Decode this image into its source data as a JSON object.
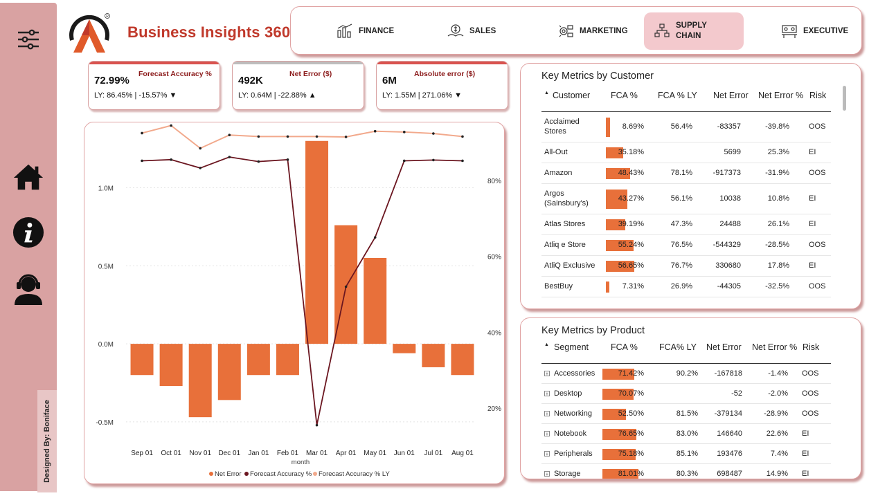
{
  "app": {
    "brand": "Business Insights 360",
    "designed_by": "Designed By: Boniface",
    "colors": {
      "accent": "#c0392b",
      "sidebar": "#d9a2a2",
      "bar": "#e8703a",
      "fca_line": "#6b1620",
      "fca_ly_line": "#f2a98c",
      "active_tab": "#f3c9cd"
    }
  },
  "sidebar": {
    "items": [
      {
        "icon": "filter-sliders-icon"
      },
      {
        "icon": "home-icon"
      },
      {
        "icon": "info-icon"
      },
      {
        "icon": "support-agent-icon"
      }
    ]
  },
  "nav": {
    "tabs": [
      {
        "label": "FINANCE",
        "icon": "finance-icon"
      },
      {
        "label": "SALES",
        "icon": "sales-icon"
      },
      {
        "label": "MARKETING",
        "icon": "marketing-icon"
      },
      {
        "label_1": "SUPPLY",
        "label_2": "CHAIN",
        "icon": "supply-chain-icon",
        "active": true
      },
      {
        "label": "EXECUTIVE",
        "icon": "executive-icon"
      }
    ]
  },
  "kpis": [
    {
      "value": "72.99%",
      "title": "Forecast Accuracy %",
      "ly": "LY: 86.45% | -15.57% ▼",
      "bar_color": "#d9534f"
    },
    {
      "value": "492K",
      "title": "Net Error ($)",
      "ly": "LY: 0.64M | -22.88% ▲",
      "bar_color": "#bdbdbd"
    },
    {
      "value": "6M",
      "title": "Absolute error ($)",
      "ly": "LY: 1.55M | 271.06% ▼",
      "bar_color": "#d9534f"
    }
  ],
  "chart_data": {
    "type": "bar",
    "categories": [
      "Sep 01",
      "Oct 01",
      "Nov 01",
      "Dec 01",
      "Jan 01",
      "Feb 01",
      "Mar 01",
      "Apr 01",
      "May 01",
      "Jun 01",
      "Jul 01",
      "Aug 01"
    ],
    "xlabel": "month",
    "y_left": {
      "ticks": [
        "1.0M",
        "0.5M",
        "0.0M",
        "-0.5M"
      ],
      "ylim": [
        -0.62,
        1.33
      ]
    },
    "y_right": {
      "ticks": [
        "80%",
        "60%",
        "40%",
        "20%"
      ]
    },
    "series": [
      {
        "name": "Net Error",
        "type": "bar",
        "axis": "left",
        "values": [
          -0.2,
          -0.27,
          -0.47,
          -0.36,
          -0.2,
          -0.2,
          1.3,
          0.76,
          0.55,
          -0.06,
          -0.15,
          -0.2
        ]
      },
      {
        "name": "Forecast Accuracy %",
        "type": "line",
        "axis": "right",
        "values": [
          85.2,
          85.5,
          83.3,
          86.2,
          85.0,
          85.5,
          15.5,
          52.0,
          65.0,
          85.2,
          85.4,
          85.2
        ]
      },
      {
        "name": "Forecast Accuracy % LY",
        "type": "line",
        "axis": "right",
        "values": [
          92.5,
          94.5,
          88.5,
          92.0,
          91.6,
          91.6,
          91.6,
          91.5,
          93.0,
          92.8,
          92.4,
          91.6
        ]
      }
    ],
    "legend": [
      "Net Error",
      "Forecast Accuracy %",
      "Forecast Accuracy % LY"
    ]
  },
  "customers": {
    "title": "Key Metrics by Customer",
    "columns": [
      "Customer",
      "FCA %",
      "FCA % LY",
      "Net Error",
      "Net Error %",
      "Risk"
    ],
    "rows": [
      {
        "name_1": "Acclaimed",
        "name_2": "Stores",
        "fca": "8.69%",
        "fca_frac": 0.087,
        "fca_ly": "56.4%",
        "net_error": "-83357",
        "net_error_pct": "-39.8%",
        "risk": "OOS"
      },
      {
        "name_1": "All-Out",
        "name_2": "",
        "fca": "35.18%",
        "fca_frac": 0.352,
        "fca_ly": "",
        "net_error": "5699",
        "net_error_pct": "25.3%",
        "risk": "EI"
      },
      {
        "name_1": "Amazon",
        "name_2": "",
        "fca": "48.43%",
        "fca_frac": 0.484,
        "fca_ly": "78.1%",
        "net_error": "-917373",
        "net_error_pct": "-31.9%",
        "risk": "OOS"
      },
      {
        "name_1": "Argos",
        "name_2": "(Sainsbury's)",
        "fca": "43.27%",
        "fca_frac": 0.433,
        "fca_ly": "56.1%",
        "net_error": "10038",
        "net_error_pct": "10.8%",
        "risk": "EI"
      },
      {
        "name_1": "Atlas Stores",
        "name_2": "",
        "fca": "39.19%",
        "fca_frac": 0.392,
        "fca_ly": "47.3%",
        "net_error": "24488",
        "net_error_pct": "26.1%",
        "risk": "EI"
      },
      {
        "name_1": "Atliq e Store",
        "name_2": "",
        "fca": "55.24%",
        "fca_frac": 0.552,
        "fca_ly": "76.5%",
        "net_error": "-544329",
        "net_error_pct": "-28.5%",
        "risk": "OOS"
      },
      {
        "name_1": "AtliQ Exclusive",
        "name_2": "",
        "fca": "56.65%",
        "fca_frac": 0.567,
        "fca_ly": "76.7%",
        "net_error": "330680",
        "net_error_pct": "17.8%",
        "risk": "EI"
      },
      {
        "name_1": "BestBuy",
        "name_2": "",
        "fca": "7.31%",
        "fca_frac": 0.073,
        "fca_ly": "26.9%",
        "net_error": "-44305",
        "net_error_pct": "-32.5%",
        "risk": "OOS"
      }
    ]
  },
  "products": {
    "title": "Key Metrics by Product",
    "columns": [
      "Segment",
      "FCA %",
      "FCA% LY",
      "Net Error",
      "Net Error %",
      "Risk"
    ],
    "rows": [
      {
        "name": "Accessories",
        "fca": "71.42%",
        "fca_frac": 0.714,
        "fca_ly": "90.2%",
        "net_error": "-167818",
        "net_error_pct": "-1.4%",
        "risk": "OOS"
      },
      {
        "name": "Desktop",
        "fca": "70.07%",
        "fca_frac": 0.701,
        "fca_ly": "",
        "net_error": "-52",
        "net_error_pct": "-2.0%",
        "risk": "OOS"
      },
      {
        "name": "Networking",
        "fca": "52.50%",
        "fca_frac": 0.525,
        "fca_ly": "81.5%",
        "net_error": "-379134",
        "net_error_pct": "-28.9%",
        "risk": "OOS"
      },
      {
        "name": "Notebook",
        "fca": "76.65%",
        "fca_frac": 0.767,
        "fca_ly": "83.0%",
        "net_error": "146640",
        "net_error_pct": "22.6%",
        "risk": "EI"
      },
      {
        "name": "Peripherals",
        "fca": "75.18%",
        "fca_frac": 0.752,
        "fca_ly": "85.1%",
        "net_error": "193476",
        "net_error_pct": "7.4%",
        "risk": "EI"
      },
      {
        "name": "Storage",
        "fca": "81.01%",
        "fca_frac": 0.81,
        "fca_ly": "80.3%",
        "net_error": "698487",
        "net_error_pct": "14.9%",
        "risk": "EI"
      }
    ]
  }
}
